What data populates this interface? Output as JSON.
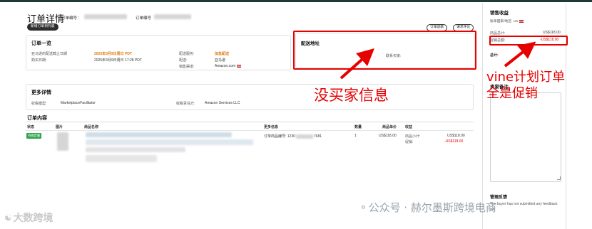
{
  "header": {
    "title": "订单详情",
    "order_no_label": "订单编号：",
    "order_no_label2": "订单编号",
    "new_order_button": "新增订单到列表",
    "refund_button": "订单退款",
    "action_button": "请求评论"
  },
  "summary": {
    "title": "订单一览",
    "rows": [
      {
        "label": "亚马逊的配送截止日期",
        "value": "2025年3月9日周日 PDT",
        "label2": "配送服务:",
        "value2": "加急配送"
      },
      {
        "label": "购买日期:",
        "value": "2025年3月9日周日 17:28 PDT",
        "label2": "配送:",
        "value2": "亚马逊"
      },
      {
        "label": "",
        "value": "",
        "label2": "销售渠道:",
        "value2": "Amazon.com"
      }
    ]
  },
  "shipping": {
    "title": "配送地址",
    "contact_label": "联系买家:"
  },
  "more_details": {
    "title": "更多详情",
    "label1": "收税模型:",
    "value1": "MarketplaceFacilitator",
    "label2": "收税责任方:",
    "value2": "Amazon Services LLC"
  },
  "order_contents": {
    "title": "订单内容",
    "columns": [
      "状态",
      "图片",
      "商品名称",
      "更多信息",
      "数量",
      "商品单价",
      "收益"
    ],
    "row": {
      "status": "待确定量",
      "item_no_prefix": "订单商品编号: 1230",
      "item_no_suffix": "7681",
      "qty": "1",
      "unit_price": "US$118.00",
      "earn_label1": "商品小计:",
      "earn_value1": "US$118.00",
      "earn_label2": "促销:",
      "earn_value2": "-US$118.00"
    }
  },
  "sidebar": {
    "revenue_title": "销售收益",
    "marketplace_label": "账单国家/地区: US",
    "rows": [
      {
        "label": "商品总计:",
        "value": "US$118.00"
      },
      {
        "label": "促销总额:",
        "value": "-US$118.00"
      }
    ],
    "total_label": "总计:",
    "notes_title": "卖家备注",
    "feedback_title": "管理反馈",
    "feedback_text": "The buyer has not submitted any feedback yet"
  },
  "annotations": {
    "no_buyer": "没买家信息",
    "vine_line1": "vine计划订单",
    "vine_line2": "全是促销"
  },
  "watermark": {
    "left": "大数跨境",
    "right": "公众号 · 赫尔墨斯跨境电商"
  },
  "colors": {
    "annotation_red": "#e60000",
    "promo_orange": "#e07a10",
    "status_green": "#2ea44f",
    "topbar": "#1f3a36"
  }
}
